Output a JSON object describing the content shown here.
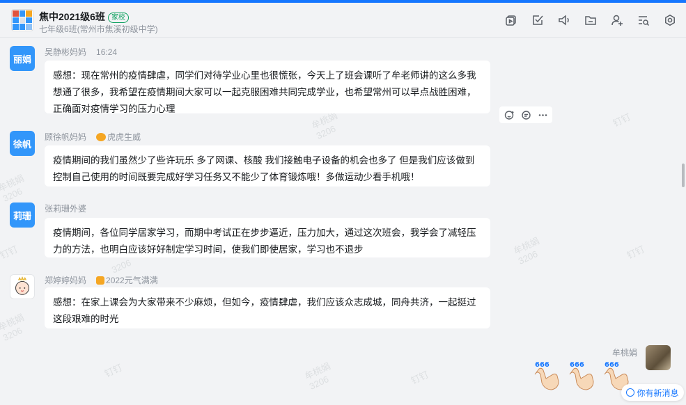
{
  "header": {
    "group_title": "焦中2021级6班",
    "group_tag": "家校",
    "group_subtitle": "七年级6班(常州市焦溪初级中学)",
    "tools": [
      "video-icon",
      "todo-check-icon",
      "announce-icon",
      "folder-icon",
      "add-member-icon",
      "search-list-icon",
      "settings-icon"
    ]
  },
  "messages": [
    {
      "avatar_text": "丽娟",
      "sender": "吴静彬妈妈",
      "time": "16:24",
      "text": "感想：现在常州的疫情肆虐，同学们对待学业心里也很慌张，今天上了班会课听了牟老师讲的这么多我想通了很多，我希望在疫情期间大家可以一起克服困难共同完成学业，也希望常州可以早点战胜困难，正确面对疫情学习的压力心理"
    },
    {
      "avatar_text": "徐帆",
      "sender": "顾徐帆妈妈",
      "badge": "虎虎生威",
      "text": "疫情期间的我们虽然少了些许玩乐 多了网课、核酸 我们接触电子设备的机会也多了 但是我们应该做到控制自己使用的时间既要完成好学习任务又不能少了体育锻炼哦！多做运动少看手机哦！"
    },
    {
      "avatar_text": "莉珊",
      "sender": "张莉珊外婆",
      "text": "疫情期间，各位同学居家学习，而期中考试正在步步逼近，压力加大，通过这次班会，我学会了减轻压力的方法，也明白应该好好制定学习时间，使我们即使居家，学习也不退步"
    },
    {
      "sender": "郑婷婷妈妈",
      "badge": "2022元气满满",
      "text": "感想：在家上课会为大家带来不少麻烦，但如今，疫情肆虐，我们应该众志成城，同舟共济，一起挺过这段艰难的时光"
    }
  ],
  "self": {
    "name": "牟桃娟"
  },
  "watermark": {
    "name": "牟桃娟",
    "code": "3206",
    "app": "钉钉"
  },
  "new_message_label": "你有新消息",
  "colors": {
    "accent": "#1677ff",
    "avatar_blue": "#3296fa",
    "tag_green": "#0aa05d"
  }
}
